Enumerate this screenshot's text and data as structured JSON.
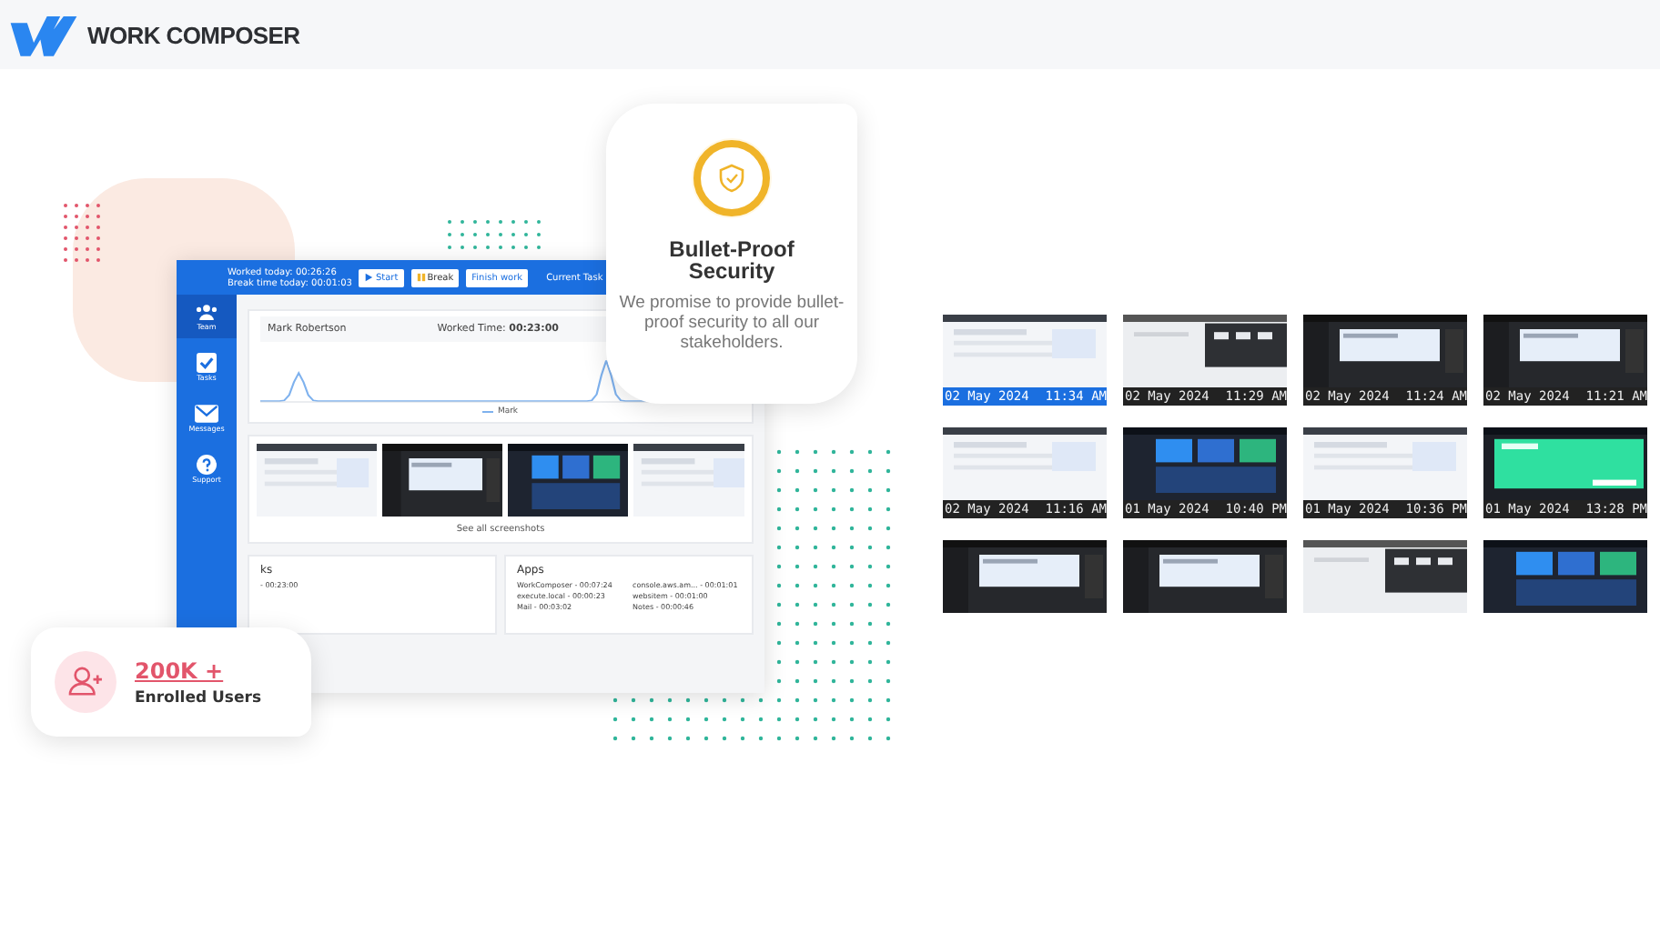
{
  "brand": {
    "name": "WORK COMPOSER"
  },
  "app": {
    "timer": [
      "Worked today: 00:26:26",
      "Break time today: 00:01:03"
    ],
    "buttons": [
      {
        "label": "Start",
        "kind": "play"
      },
      {
        "label": "Break",
        "kind": "pause"
      },
      {
        "label": "Finish work",
        "kind": "plain"
      }
    ],
    "current_task": "Current Task",
    "nav": [
      {
        "label": "Team",
        "kind": "team",
        "selected": true
      },
      {
        "label": "Tasks",
        "kind": "tasks",
        "selected": false
      },
      {
        "label": "Messages",
        "kind": "messages",
        "selected": false
      },
      {
        "label": "Support",
        "kind": "support",
        "selected": false
      }
    ],
    "user": "Mark Robertson",
    "worked_label": "Worked Time:",
    "worked_time": "00:23:00",
    "legend": "Mark",
    "screenshots": [
      {
        "kind": "light"
      },
      {
        "kind": "dark"
      },
      {
        "kind": "blue"
      },
      {
        "kind": "light"
      }
    ],
    "see_all": "See all screenshots",
    "tasks": {
      "title": "ks",
      "rows": [
        "- 00:23:00"
      ]
    },
    "apps": {
      "title": "Apps",
      "rows": [
        "WorkComposer - 00:07:24",
        "console.aws.am... - 00:01:01",
        "execute.local - 00:00:23",
        "websitem - 00:01:00",
        "Mail - 00:03:02",
        "Notes - 00:00:46"
      ]
    }
  },
  "security": {
    "title": "Bullet-Proof Security",
    "text": "We promise to provide bullet-proof security to all our stakeholders."
  },
  "enrolled": {
    "count": "200K +",
    "label": "Enrolled Users"
  },
  "gallery": [
    {
      "kind": "light",
      "date": "02 May 2024",
      "time": "11:34 AM",
      "selected": true
    },
    {
      "kind": "gray",
      "date": "02 May 2024",
      "time": "11:29 AM",
      "selected": false
    },
    {
      "kind": "dark",
      "date": "02 May 2024",
      "time": "11:24 AM",
      "selected": false
    },
    {
      "kind": "dark",
      "date": "02 May 2024",
      "time": "11:21 AM",
      "selected": false
    },
    {
      "kind": "light",
      "date": "02 May 2024",
      "time": "11:16 AM",
      "selected": false
    },
    {
      "kind": "blue",
      "date": "01 May 2024",
      "time": "10:40 PM",
      "selected": false
    },
    {
      "kind": "light",
      "date": "01 May 2024",
      "time": "10:36 PM",
      "selected": false
    },
    {
      "kind": "green",
      "date": "01 May 2024",
      "time": "13:28 PM",
      "selected": false
    },
    {
      "kind": "dark"
    },
    {
      "kind": "dark"
    },
    {
      "kind": "gray"
    },
    {
      "kind": "blue"
    }
  ]
}
